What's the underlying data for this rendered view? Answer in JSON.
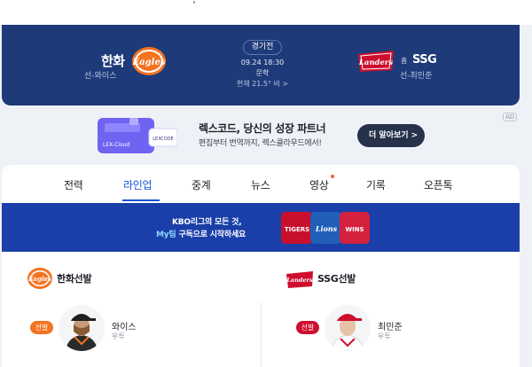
{
  "scoreboard": {
    "status": "경기전",
    "datetime": "09.24 18:30",
    "stadium": "문학",
    "weather": "현재 21.5° 비 >",
    "home": {
      "name": "한화",
      "pitcher": "선-와이스",
      "logo_text": "Eagles"
    },
    "away": {
      "name": "SSG",
      "mark": "홈",
      "pitcher": "선-최민준",
      "logo_text": "Landers"
    }
  },
  "ad": {
    "title": "렉스코드, 당신의 성장 파트너",
    "description": "편집부터 번역까지, 렉스클라우드에서!",
    "cta": "더 알아보기 >",
    "badge": "AD",
    "graphic_labels": {
      "left": "LEX-Cloud",
      "right": "LEXCODE"
    }
  },
  "tabs": [
    {
      "label": "전력",
      "active": false
    },
    {
      "label": "라인업",
      "active": true
    },
    {
      "label": "중계",
      "active": false
    },
    {
      "label": "뉴스",
      "active": false
    },
    {
      "label": "영상",
      "active": false,
      "dot": true
    },
    {
      "label": "기록",
      "active": false
    },
    {
      "label": "오픈톡",
      "active": false
    }
  ],
  "promo": {
    "line1": "KBO리그의 모든 것,",
    "line2_highlight": "My팀",
    "line2_rest": " 구독으로 시작하세요",
    "card_labels": [
      "TIGERS",
      "Lions",
      "WINS"
    ]
  },
  "starters": {
    "home": {
      "title": "한화선발",
      "badge": "선발",
      "name": "와이스",
      "hand": "우투"
    },
    "away": {
      "title": "SSG선발",
      "badge": "선발",
      "name": "최민준",
      "hand": "우투"
    }
  },
  "colors": {
    "scoreboard_bg": "#1e3a78",
    "accent_blue": "#1553d6",
    "eagles_orange": "#f37321",
    "landers_red": "#ce0e2d"
  }
}
